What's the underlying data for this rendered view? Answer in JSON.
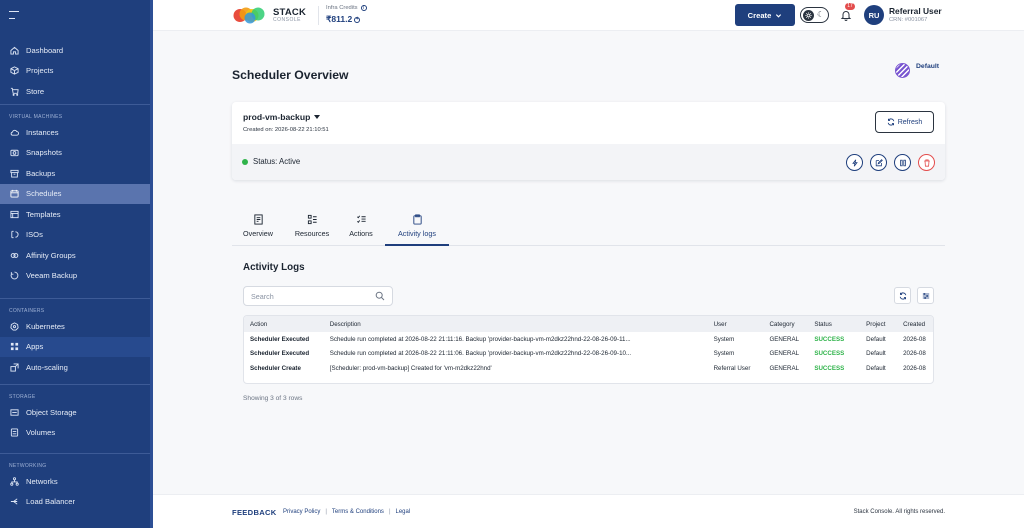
{
  "sidebar": {
    "items_top": [
      {
        "label": "Dashboard",
        "icon": "home-icon"
      },
      {
        "label": "Projects",
        "icon": "box-icon"
      },
      {
        "label": "Store",
        "icon": "cart-icon"
      }
    ],
    "section_vm": "VIRTUAL MACHINES",
    "items_vm": [
      {
        "label": "Instances",
        "icon": "cloud-icon"
      },
      {
        "label": "Snapshots",
        "icon": "camera-icon"
      },
      {
        "label": "Backups",
        "icon": "archive-icon"
      },
      {
        "label": "Schedules",
        "icon": "calendar-icon"
      },
      {
        "label": "Templates",
        "icon": "template-icon"
      },
      {
        "label": "ISOs",
        "icon": "disc-icon"
      },
      {
        "label": "Affinity Groups",
        "icon": "affinity-icon"
      },
      {
        "label": "Veeam Backup",
        "icon": "veeam-icon"
      }
    ],
    "section_containers": "CONTAINERS",
    "items_containers": [
      {
        "label": "Kubernetes",
        "icon": "kubernetes-icon"
      },
      {
        "label": "Apps",
        "icon": "apps-icon"
      },
      {
        "label": "Auto-scaling",
        "icon": "autoscale-icon"
      }
    ],
    "section_storage": "STORAGE",
    "items_storage": [
      {
        "label": "Object Storage",
        "icon": "object-storage-icon"
      },
      {
        "label": "Volumes",
        "icon": "volume-icon"
      }
    ],
    "section_networking": "NETWORKING",
    "items_networking": [
      {
        "label": "Networks",
        "icon": "network-icon"
      },
      {
        "label": "Load Balancer",
        "icon": "load-balancer-icon"
      }
    ]
  },
  "header": {
    "logo_title": "STACK",
    "logo_subtitle": "CONSOLE",
    "credits_label": "Infra Credits",
    "credits_value": "₹811.2",
    "create_label": "Create",
    "notification_count": "17",
    "avatar_initials": "RU",
    "user_name": "Referral User",
    "user_crn": "CRN: #001067"
  },
  "page": {
    "title": "Scheduler Overview",
    "project_name": "Default"
  },
  "schedule": {
    "name": "prod-vm-backup",
    "created": "Created on: 2026-08-22 21:10:51",
    "refresh_label": "Refresh",
    "status": "Status: Active"
  },
  "tabs": [
    {
      "label": "Overview",
      "icon": "overview-icon"
    },
    {
      "label": "Resources",
      "icon": "resources-icon"
    },
    {
      "label": "Actions",
      "icon": "actions-icon"
    },
    {
      "label": "Activity logs",
      "icon": "clipboard-icon"
    }
  ],
  "logs": {
    "title": "Activity Logs",
    "search_placeholder": "Search",
    "columns": [
      "Action",
      "Description",
      "User",
      "Category",
      "Status",
      "Project",
      "Created"
    ],
    "rows": [
      [
        "Scheduler Executed",
        "Schedule run completed at 2026-08-22 21:11:16. Backup 'provider-backup-vm-m2dkz22hnd-22-08-26-09-11...",
        "System",
        "GENERAL",
        "SUCCESS",
        "Default",
        "2026-08"
      ],
      [
        "Scheduler Executed",
        "Schedule run completed at 2026-08-22 21:11:06. Backup 'provider-backup-vm-m2dkz22hnd-22-08-26-09-10...",
        "System",
        "GENERAL",
        "SUCCESS",
        "Default",
        "2026-08"
      ],
      [
        "Scheduler Create",
        "[Scheduler: prod-vm-backup] Created for 'vm-m2dkz22hnd'",
        "Referral User",
        "GENERAL",
        "SUCCESS",
        "Default",
        "2026-08"
      ]
    ],
    "showing": "Showing 3 of 3 rows"
  },
  "footer": {
    "feedback": "FEEDBACK",
    "links": [
      "Privacy Policy",
      "Terms & Conditions",
      "Legal"
    ],
    "separator": "|",
    "copyright": "Stack Console. All rights reserved."
  },
  "colors": {
    "sidebar_bg": "#1f3f7d",
    "accent": "#1f3f7d",
    "success": "#2fb34a",
    "danger": "#e34d4d"
  }
}
